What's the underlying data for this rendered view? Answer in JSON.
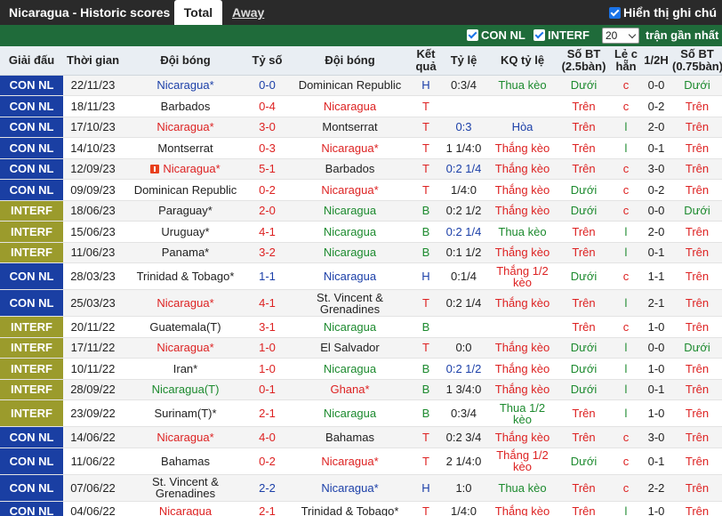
{
  "header": {
    "title": "Nicaragua - Historic scores",
    "tab_total": "Total",
    "tab_away": "Away",
    "show_notes_label": "Hiển thị ghi chú"
  },
  "filters": {
    "con_nl_label": "CON NL",
    "interf_label": "INTERF",
    "count_value": "20",
    "recent_label": "trận gần nhất"
  },
  "columns": [
    "Giải đấu",
    "Thời gian",
    "Đội bóng",
    "Tỷ số",
    "Đội bóng",
    "Kết quả",
    "Tỷ lệ",
    "KQ tỷ lệ",
    "Số BT (2.5bàn)",
    "Lẻ c hẵn",
    "1/2H",
    "Số BT (0.75bàn)"
  ],
  "colors": {
    "con_nl": "#1a3fa3",
    "interf": "#9b9b2c",
    "header_bar": "#2a2a2a",
    "filter_bar": "#1f6b3a",
    "red": "#dd2222",
    "blue": "#1b3fa8",
    "green": "#1c8a2e"
  },
  "rows": [
    {
      "league": "CON NL",
      "lt": "con",
      "date": "22/11/23",
      "home": "Nicaragua*",
      "hc": "blue",
      "score": "0-0",
      "sc": "blue",
      "away": "Dominican Republic",
      "ac": "",
      "res": "H",
      "rc": "blue",
      "odds": "0:3/4",
      "oc": "",
      "ko": "Thua kèo",
      "kc": "green",
      "bt": "Dưới",
      "btc": "green",
      "lc": "c",
      "lcc": "red",
      "h2": "0-0",
      "bt2": "Dưới",
      "bt2c": "green"
    },
    {
      "league": "CON NL",
      "lt": "con",
      "date": "18/11/23",
      "home": "Barbados",
      "hc": "",
      "score": "0-4",
      "sc": "red",
      "away": "Nicaragua",
      "ac": "red",
      "res": "T",
      "rc": "red",
      "odds": "",
      "oc": "",
      "ko": "",
      "kc": "",
      "bt": "Trên",
      "btc": "red",
      "lc": "c",
      "lcc": "red",
      "h2": "0-2",
      "bt2": "Trên",
      "bt2c": "red"
    },
    {
      "league": "CON NL",
      "lt": "con",
      "date": "17/10/23",
      "home": "Nicaragua*",
      "hc": "red",
      "score": "3-0",
      "sc": "red",
      "away": "Montserrat",
      "ac": "",
      "res": "T",
      "rc": "red",
      "odds": "0:3",
      "oc": "blue",
      "ko": "Hòa",
      "kc": "blue",
      "bt": "Trên",
      "btc": "red",
      "lc": "l",
      "lcc": "green",
      "h2": "2-0",
      "bt2": "Trên",
      "bt2c": "red"
    },
    {
      "league": "CON NL",
      "lt": "con",
      "date": "14/10/23",
      "home": "Montserrat",
      "hc": "",
      "score": "0-3",
      "sc": "red",
      "away": "Nicaragua*",
      "ac": "red",
      "res": "T",
      "rc": "red",
      "odds": "1 1/4:0",
      "oc": "",
      "ko": "Thắng kèo",
      "kc": "red",
      "bt": "Trên",
      "btc": "red",
      "lc": "l",
      "lcc": "green",
      "h2": "0-1",
      "bt2": "Trên",
      "bt2c": "red"
    },
    {
      "league": "CON NL",
      "lt": "con",
      "date": "12/09/23",
      "home": "Nicaragua*",
      "hc": "red",
      "flag": true,
      "score": "5-1",
      "sc": "red",
      "away": "Barbados",
      "ac": "",
      "res": "T",
      "rc": "red",
      "odds": "0:2 1/4",
      "oc": "blue",
      "ko": "Thắng kèo",
      "kc": "red",
      "bt": "Trên",
      "btc": "red",
      "lc": "c",
      "lcc": "red",
      "h2": "3-0",
      "bt2": "Trên",
      "bt2c": "red"
    },
    {
      "league": "CON NL",
      "lt": "con",
      "date": "09/09/23",
      "home": "Dominican Republic",
      "hc": "",
      "score": "0-2",
      "sc": "red",
      "away": "Nicaragua*",
      "ac": "red",
      "res": "T",
      "rc": "red",
      "odds": "1/4:0",
      "oc": "",
      "ko": "Thắng kèo",
      "kc": "red",
      "bt": "Dưới",
      "btc": "green",
      "lc": "c",
      "lcc": "red",
      "h2": "0-2",
      "bt2": "Trên",
      "bt2c": "red"
    },
    {
      "league": "INTERF",
      "lt": "interf",
      "date": "18/06/23",
      "home": "Paraguay*",
      "hc": "",
      "score": "2-0",
      "sc": "red",
      "away": "Nicaragua",
      "ac": "green",
      "res": "B",
      "rc": "green",
      "odds": "0:2 1/2",
      "oc": "",
      "ko": "Thắng kèo",
      "kc": "red",
      "bt": "Dưới",
      "btc": "green",
      "lc": "c",
      "lcc": "red",
      "h2": "0-0",
      "bt2": "Dưới",
      "bt2c": "green"
    },
    {
      "league": "INTERF",
      "lt": "interf",
      "date": "15/06/23",
      "home": "Uruguay*",
      "hc": "",
      "score": "4-1",
      "sc": "red",
      "away": "Nicaragua",
      "ac": "green",
      "res": "B",
      "rc": "green",
      "odds": "0:2 1/4",
      "oc": "blue",
      "ko": "Thua kèo",
      "kc": "green",
      "bt": "Trên",
      "btc": "red",
      "lc": "l",
      "lcc": "green",
      "h2": "2-0",
      "bt2": "Trên",
      "bt2c": "red"
    },
    {
      "league": "INTERF",
      "lt": "interf",
      "date": "11/06/23",
      "home": "Panama*",
      "hc": "",
      "score": "3-2",
      "sc": "red",
      "away": "Nicaragua",
      "ac": "green",
      "res": "B",
      "rc": "green",
      "odds": "0:1 1/2",
      "oc": "",
      "ko": "Thắng kèo",
      "kc": "red",
      "bt": "Trên",
      "btc": "red",
      "lc": "l",
      "lcc": "green",
      "h2": "0-1",
      "bt2": "Trên",
      "bt2c": "red"
    },
    {
      "league": "CON NL",
      "lt": "con",
      "date": "28/03/23",
      "home": "Trinidad & Tobago*",
      "hc": "",
      "score": "1-1",
      "sc": "blue",
      "away": "Nicaragua",
      "ac": "blue",
      "res": "H",
      "rc": "blue",
      "odds": "0:1/4",
      "oc": "",
      "ko": "Thắng 1/2 kèo",
      "kc": "red",
      "bt": "Dưới",
      "btc": "green",
      "lc": "c",
      "lcc": "red",
      "h2": "1-1",
      "bt2": "Trên",
      "bt2c": "red",
      "tall": true
    },
    {
      "league": "CON NL",
      "lt": "con",
      "date": "25/03/23",
      "home": "Nicaragua*",
      "hc": "red",
      "score": "4-1",
      "sc": "red",
      "away": "St. Vincent & Grenadines",
      "ac": "",
      "res": "T",
      "rc": "red",
      "odds": "0:2 1/4",
      "oc": "",
      "ko": "Thắng kèo",
      "kc": "red",
      "bt": "Trên",
      "btc": "red",
      "lc": "l",
      "lcc": "green",
      "h2": "2-1",
      "bt2": "Trên",
      "bt2c": "red",
      "tall": true
    },
    {
      "league": "INTERF",
      "lt": "interf",
      "date": "20/11/22",
      "home": "Guatemala(T)",
      "hc": "",
      "score": "3-1",
      "sc": "red",
      "away": "Nicaragua",
      "ac": "green",
      "res": "B",
      "rc": "green",
      "odds": "",
      "oc": "",
      "ko": "",
      "kc": "",
      "bt": "Trên",
      "btc": "red",
      "lc": "c",
      "lcc": "red",
      "h2": "1-0",
      "bt2": "Trên",
      "bt2c": "red"
    },
    {
      "league": "INTERF",
      "lt": "interf",
      "date": "17/11/22",
      "home": "Nicaragua*",
      "hc": "red",
      "score": "1-0",
      "sc": "red",
      "away": "El Salvador",
      "ac": "",
      "res": "T",
      "rc": "red",
      "odds": "0:0",
      "oc": "",
      "ko": "Thắng kèo",
      "kc": "red",
      "bt": "Dưới",
      "btc": "green",
      "lc": "l",
      "lcc": "green",
      "h2": "0-0",
      "bt2": "Dưới",
      "bt2c": "green"
    },
    {
      "league": "INTERF",
      "lt": "interf",
      "date": "10/11/22",
      "home": "Iran*",
      "hc": "",
      "score": "1-0",
      "sc": "red",
      "away": "Nicaragua",
      "ac": "green",
      "res": "B",
      "rc": "green",
      "odds": "0:2 1/2",
      "oc": "blue",
      "ko": "Thắng kèo",
      "kc": "red",
      "bt": "Dưới",
      "btc": "green",
      "lc": "l",
      "lcc": "green",
      "h2": "1-0",
      "bt2": "Trên",
      "bt2c": "red"
    },
    {
      "league": "INTERF",
      "lt": "interf",
      "date": "28/09/22",
      "home": "Nicaragua(T)",
      "hc": "green",
      "score": "0-1",
      "sc": "red",
      "away": "Ghana*",
      "ac": "red",
      "res": "B",
      "rc": "green",
      "odds": "1 3/4:0",
      "oc": "",
      "ko": "Thắng kèo",
      "kc": "red",
      "bt": "Dưới",
      "btc": "green",
      "lc": "l",
      "lcc": "green",
      "h2": "0-1",
      "bt2": "Trên",
      "bt2c": "red"
    },
    {
      "league": "INTERF",
      "lt": "interf",
      "date": "23/09/22",
      "home": "Surinam(T)*",
      "hc": "",
      "score": "2-1",
      "sc": "red",
      "away": "Nicaragua",
      "ac": "green",
      "res": "B",
      "rc": "green",
      "odds": "0:3/4",
      "oc": "",
      "ko": "Thua 1/2 kèo",
      "kc": "green",
      "bt": "Trên",
      "btc": "red",
      "lc": "l",
      "lcc": "green",
      "h2": "1-0",
      "bt2": "Trên",
      "bt2c": "red",
      "tall": true
    },
    {
      "league": "CON NL",
      "lt": "con",
      "date": "14/06/22",
      "home": "Nicaragua*",
      "hc": "red",
      "score": "4-0",
      "sc": "red",
      "away": "Bahamas",
      "ac": "",
      "res": "T",
      "rc": "red",
      "odds": "0:2 3/4",
      "oc": "",
      "ko": "Thắng kèo",
      "kc": "red",
      "bt": "Trên",
      "btc": "red",
      "lc": "c",
      "lcc": "red",
      "h2": "3-0",
      "bt2": "Trên",
      "bt2c": "red"
    },
    {
      "league": "CON NL",
      "lt": "con",
      "date": "11/06/22",
      "home": "Bahamas",
      "hc": "",
      "score": "0-2",
      "sc": "red",
      "away": "Nicaragua*",
      "ac": "red",
      "res": "T",
      "rc": "red",
      "odds": "2 1/4:0",
      "oc": "",
      "ko": "Thắng 1/2 kèo",
      "kc": "red",
      "bt": "Dưới",
      "btc": "green",
      "lc": "c",
      "lcc": "red",
      "h2": "0-1",
      "bt2": "Trên",
      "bt2c": "red",
      "tall": true
    },
    {
      "league": "CON NL",
      "lt": "con",
      "date": "07/06/22",
      "home": "St. Vincent & Grenadines",
      "hc": "",
      "score": "2-2",
      "sc": "blue",
      "away": "Nicaragua*",
      "ac": "blue",
      "res": "H",
      "rc": "blue",
      "odds": "1:0",
      "oc": "",
      "ko": "Thua kèo",
      "kc": "green",
      "bt": "Trên",
      "btc": "red",
      "lc": "c",
      "lcc": "red",
      "h2": "2-2",
      "bt2": "Trên",
      "bt2c": "red",
      "tall": true
    },
    {
      "league": "CON NL",
      "lt": "con",
      "date": "04/06/22",
      "home": "Nicaragua",
      "hc": "red",
      "score": "2-1",
      "sc": "red",
      "away": "Trinidad & Tobago*",
      "ac": "",
      "res": "T",
      "rc": "red",
      "odds": "1/4:0",
      "oc": "",
      "ko": "Thắng kèo",
      "kc": "red",
      "bt": "Trên",
      "btc": "red",
      "lc": "l",
      "lcc": "green",
      "h2": "1-0",
      "bt2": "Trên",
      "bt2c": "red"
    }
  ]
}
